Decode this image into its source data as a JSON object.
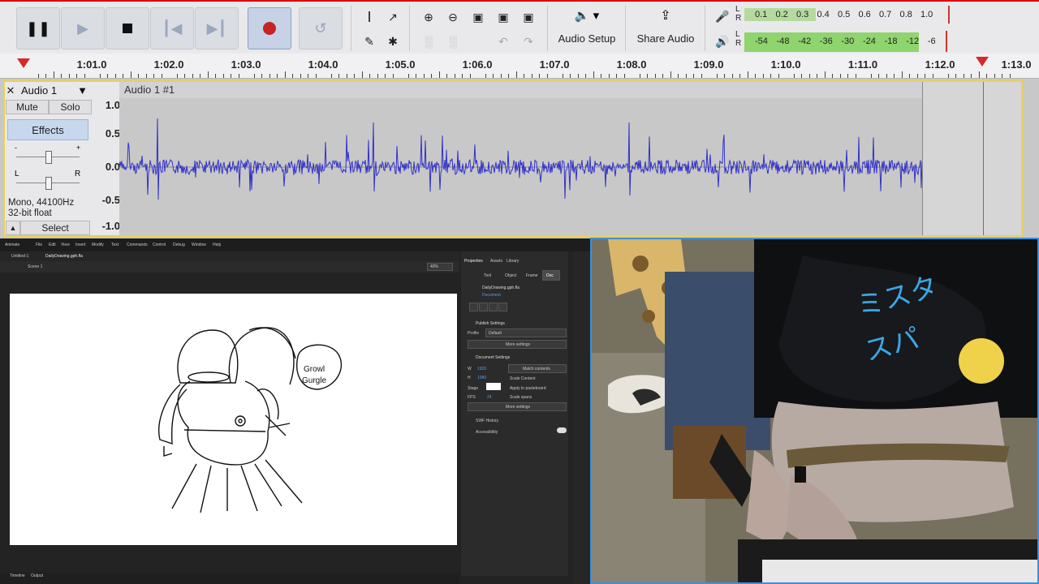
{
  "transport": {
    "pause_icon": "pause-icon",
    "play_icon": "play-icon",
    "stop_icon": "stop-icon",
    "skip_start_icon": "skip-to-start-icon",
    "skip_end_icon": "skip-to-end-icon",
    "record_icon": "record-icon",
    "loop_icon": "loop-icon"
  },
  "tools": [
    "selection-tool-icon",
    "envelope-tool-icon",
    "draw-tool-icon",
    "multi-tool-icon"
  ],
  "zoom_tools": [
    "zoom-in-icon",
    "zoom-out-icon",
    "fit-selection-icon",
    "fit-project-icon",
    "zoom-toggle-icon",
    "trim-icon",
    "silence-icon",
    "undo-icon",
    "redo-icon"
  ],
  "audio_setup": {
    "label": "Audio Setup"
  },
  "share_audio": {
    "label": "Share Audio"
  },
  "record_meter": {
    "channels": [
      "L",
      "R"
    ],
    "scale": [
      "0.1",
      "0.2",
      "0.3",
      "0.4",
      "0.5",
      "0.6",
      "0.7",
      "0.8",
      "1.0"
    ]
  },
  "play_meter": {
    "channels": [
      "L",
      "R"
    ],
    "scale": [
      "-54",
      "-48",
      "-42",
      "-36",
      "-30",
      "-24",
      "-18",
      "-12",
      "-6"
    ]
  },
  "ruler": {
    "ticks": [
      "1:01.0",
      "1:02.0",
      "1:03.0",
      "1:04.0",
      "1:05.0",
      "1:06.0",
      "1:07.0",
      "1:08.0",
      "1:09.0",
      "1:10.0",
      "1:11.0",
      "1:12.0",
      "1:13.0"
    ]
  },
  "track": {
    "name": "Audio 1",
    "mute": "Mute",
    "solo": "Solo",
    "effects": "Effects",
    "gain_minus": "-",
    "gain_plus": "+",
    "pan_left": "L",
    "pan_right": "R",
    "format_line1": "Mono, 44100Hz",
    "format_line2": "32-bit float",
    "select": "Select",
    "clip_name": "Audio 1 #1",
    "scale": [
      "1.0",
      "0.5",
      "0.0",
      "-0.5",
      "-1.0"
    ]
  },
  "animate": {
    "menu": [
      "Animate",
      "File",
      "Edit",
      "View",
      "Insert",
      "Modify",
      "Text",
      "Commands",
      "Control",
      "Debug",
      "Window",
      "Help"
    ],
    "tabs": [
      "Untitled-1",
      "DailyDrawing.gph.fla"
    ],
    "scene": "Scene 1",
    "zoom": "40%",
    "drawing_text": [
      "Growl",
      "Gurgle"
    ],
    "panel_tabs": [
      "Properties",
      "Assets",
      "Library"
    ],
    "sub_tabs": [
      "Tool",
      "Object",
      "Frame",
      "Doc"
    ],
    "doc_name": "DailyDrawing.gph.fla",
    "doc_type": "Document",
    "publish_settings": "Publish Settings",
    "profile_label": "Profile",
    "profile_value": "Default",
    "more_settings": "More settings",
    "document_settings": "Document Settings",
    "w_label": "W",
    "w_value": "1920",
    "h_label": "H",
    "h_value": "1080",
    "match_contents": "Match contents",
    "scale_content": "Scale Content",
    "apply_pasteboard": "Apply to pasteboard",
    "scale_spans": "Scale spans",
    "stage_label": "Stage",
    "fps_label": "FPS",
    "fps_value": "24",
    "more_settings_2": "More settings",
    "swf_history": "SWF History",
    "accessibility": "Accessibility",
    "timeline_tabs": [
      "Timeline",
      "Output"
    ]
  }
}
